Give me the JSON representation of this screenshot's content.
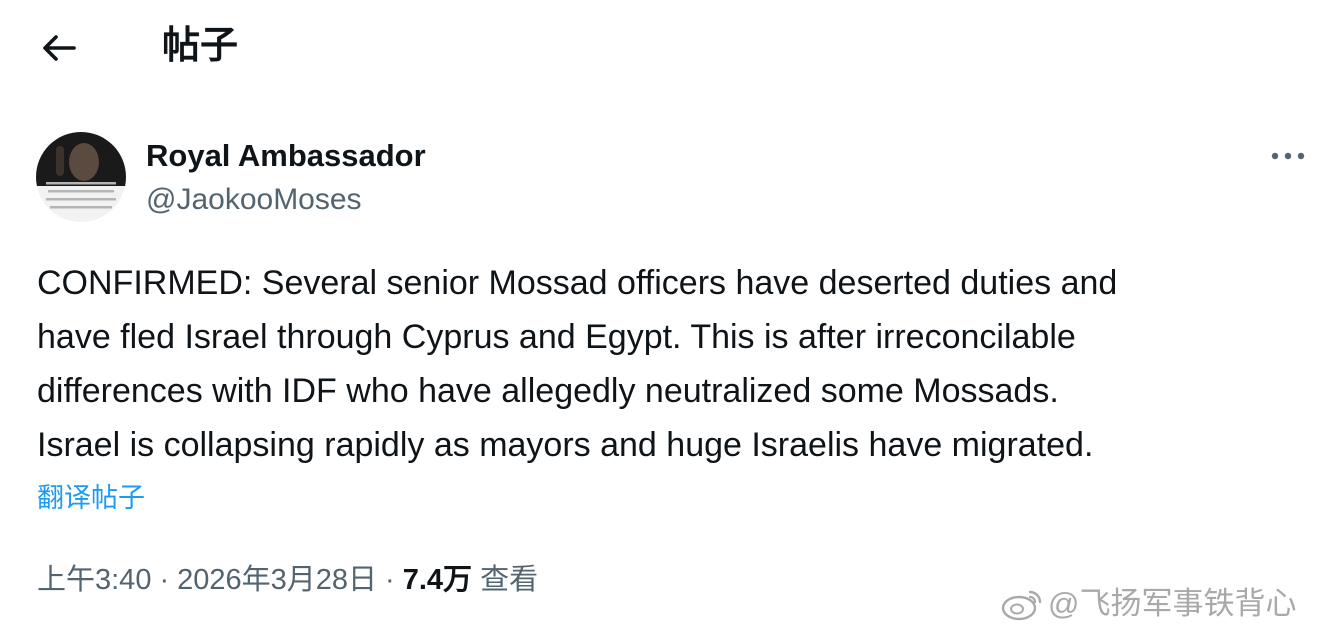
{
  "header": {
    "title": "帖子",
    "back_icon": "arrow-left-icon"
  },
  "post": {
    "author": {
      "name": "Royal Ambassador",
      "handle": "@JaokooMoses"
    },
    "more_icon": "more-horizontal-icon",
    "text_lines": [
      "CONFIRMED: Several senior Mossad officers have deserted duties and",
      "have fled Israel through Cyprus and Egypt. This is after irreconcilable",
      "differences with IDF who have allegedly neutralized some Mossads.",
      "Israel is collapsing rapidly as mayors and huge Israelis have migrated."
    ],
    "translate_label": "翻译帖子",
    "time": "上午3:40",
    "separator": "·",
    "date": "2026年3月28日",
    "views_count": "7.4万",
    "views_label": "查看"
  },
  "watermark": {
    "text": "@飞扬军事铁背心"
  },
  "colors": {
    "text": "#0f1419",
    "secondary": "#536471",
    "link": "#1d9bf0"
  }
}
